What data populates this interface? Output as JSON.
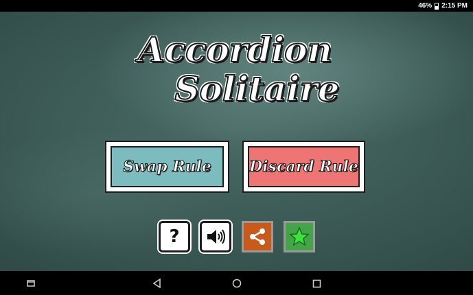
{
  "status_bar": {
    "battery": "46%",
    "time": "2:15 PM"
  },
  "title": {
    "line1": "Accordion",
    "line2": "Solitaire"
  },
  "modes": {
    "swap_label": "Swap Rule",
    "discard_label": "Discard Rule"
  },
  "toolbar": {
    "help_label": "?",
    "icons": [
      "question-icon",
      "speaker-icon",
      "share-icon",
      "star-icon"
    ]
  },
  "colors": {
    "swap": "#7cbcbe",
    "discard": "#ef7474",
    "share": "#c85a1c",
    "rate": "#45a34a",
    "board": "#34504c"
  },
  "navigation": {
    "icons": [
      "recent-apps-icon",
      "back-icon",
      "home-icon",
      "overview-icon"
    ]
  }
}
